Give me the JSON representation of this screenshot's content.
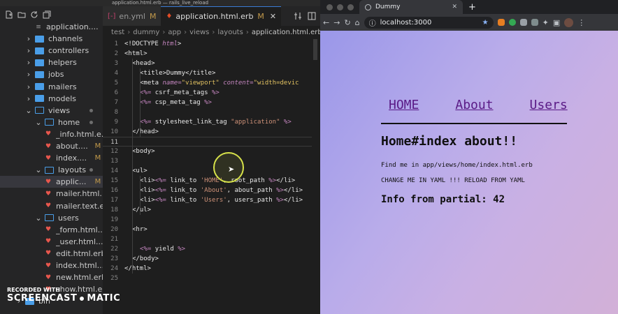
{
  "window_title": "application.html.erb — rails_live_reload",
  "explorer": {
    "rows": [
      {
        "label": "application....",
        "type": "file",
        "depth": 3,
        "icon": "css-file-icon",
        "badge": ""
      },
      {
        "label": "channels",
        "type": "folder",
        "depth": 2,
        "open": false
      },
      {
        "label": "controllers",
        "type": "folder",
        "depth": 2,
        "open": false
      },
      {
        "label": "helpers",
        "type": "folder",
        "depth": 2,
        "open": false
      },
      {
        "label": "jobs",
        "type": "folder",
        "depth": 2,
        "open": false
      },
      {
        "label": "mailers",
        "type": "folder",
        "depth": 2,
        "open": false
      },
      {
        "label": "models",
        "type": "folder",
        "depth": 2,
        "open": false
      },
      {
        "label": "views",
        "type": "folder",
        "depth": 2,
        "open": true,
        "dot": true
      },
      {
        "label": "home",
        "type": "folder",
        "depth": 3,
        "open": true,
        "dot": true
      },
      {
        "label": "_info.html.e...",
        "type": "file",
        "depth": 4,
        "icon": "ruby-file-icon",
        "badge": ""
      },
      {
        "label": "about....",
        "type": "file",
        "depth": 4,
        "icon": "ruby-file-icon",
        "badge": "M"
      },
      {
        "label": "index....",
        "type": "file",
        "depth": 4,
        "icon": "ruby-file-icon",
        "badge": "M"
      },
      {
        "label": "layouts",
        "type": "folder",
        "depth": 3,
        "open": true,
        "dot": true
      },
      {
        "label": "applic...",
        "type": "file",
        "depth": 4,
        "icon": "ruby-file-icon",
        "badge": "M",
        "selected": true
      },
      {
        "label": "mailer.html....",
        "type": "file",
        "depth": 4,
        "icon": "ruby-file-icon",
        "badge": ""
      },
      {
        "label": "mailer.text.e...",
        "type": "file",
        "depth": 4,
        "icon": "ruby-file-icon",
        "badge": ""
      },
      {
        "label": "users",
        "type": "folder",
        "depth": 3,
        "open": true
      },
      {
        "label": "_form.html....",
        "type": "file",
        "depth": 4,
        "icon": "ruby-file-icon",
        "badge": ""
      },
      {
        "label": "_user.html....",
        "type": "file",
        "depth": 4,
        "icon": "ruby-file-icon",
        "badge": ""
      },
      {
        "label": "edit.html.erb",
        "type": "file",
        "depth": 4,
        "icon": "ruby-file-icon",
        "badge": ""
      },
      {
        "label": "index.html....",
        "type": "file",
        "depth": 4,
        "icon": "ruby-file-icon",
        "badge": ""
      },
      {
        "label": "new.html.erb",
        "type": "file",
        "depth": 4,
        "icon": "ruby-file-icon",
        "badge": ""
      },
      {
        "label": "show.html.e...",
        "type": "file",
        "depth": 4,
        "icon": "ruby-file-icon",
        "badge": ""
      },
      {
        "label": "bin",
        "type": "folder",
        "depth": 1,
        "open": false
      }
    ]
  },
  "tabs": [
    {
      "label": "en.yml",
      "modified": "M",
      "icon": "yaml-file-icon",
      "active": false
    },
    {
      "label": "application.html.erb",
      "modified": "M",
      "icon": "ruby-file-icon",
      "active": true
    }
  ],
  "breadcrumb": [
    "test",
    "dummy",
    "app",
    "views",
    "layouts",
    "application.html.erb"
  ],
  "code": {
    "current_line": 11,
    "lines": [
      {
        "n": "1",
        "indent": 0,
        "parts": [
          [
            "tag",
            "<!DOCTYPE "
          ],
          [
            "attr",
            "html"
          ],
          [
            "tag",
            ">"
          ]
        ]
      },
      {
        "n": "2",
        "indent": 0,
        "parts": [
          [
            "tag",
            "<html>"
          ]
        ]
      },
      {
        "n": "3",
        "indent": 1,
        "parts": [
          [
            "tag",
            "<head>"
          ]
        ]
      },
      {
        "n": "4",
        "indent": 2,
        "parts": [
          [
            "tag",
            "<title>Dummy</title>"
          ]
        ]
      },
      {
        "n": "5",
        "indent": 2,
        "parts": [
          [
            "tag",
            "<meta "
          ],
          [
            "attr",
            "name="
          ],
          [
            "str2",
            "\"viewport\" "
          ],
          [
            "attr",
            "content="
          ],
          [
            "str2",
            "\"width=devic"
          ]
        ]
      },
      {
        "n": "6",
        "indent": 2,
        "parts": [
          [
            "erb",
            "<%= "
          ],
          [
            "tag",
            "csrf_meta_tags "
          ],
          [
            "erb",
            "%>"
          ]
        ]
      },
      {
        "n": "7",
        "indent": 2,
        "parts": [
          [
            "erb",
            "<%= "
          ],
          [
            "tag",
            "csp_meta_tag "
          ],
          [
            "erb",
            "%>"
          ]
        ]
      },
      {
        "n": "8",
        "indent": 0,
        "parts": []
      },
      {
        "n": "9",
        "indent": 2,
        "parts": [
          [
            "erb",
            "<%= "
          ],
          [
            "tag",
            "stylesheet_link_tag "
          ],
          [
            "str",
            "\"application\" "
          ],
          [
            "erb",
            "%>"
          ]
        ]
      },
      {
        "n": "10",
        "indent": 1,
        "parts": [
          [
            "tag",
            "</head>"
          ]
        ]
      },
      {
        "n": "11",
        "indent": 0,
        "parts": []
      },
      {
        "n": "12",
        "indent": 1,
        "parts": [
          [
            "tag",
            "<body>"
          ]
        ]
      },
      {
        "n": "13",
        "indent": 0,
        "parts": []
      },
      {
        "n": "14",
        "indent": 1,
        "parts": [
          [
            "tag",
            "<ul>"
          ]
        ]
      },
      {
        "n": "15",
        "indent": 2,
        "parts": [
          [
            "tag",
            "<li>"
          ],
          [
            "erb",
            "<%= "
          ],
          [
            "tag",
            "link_to "
          ],
          [
            "str",
            "'HOME'"
          ],
          [
            "tag",
            ", root_path "
          ],
          [
            "erb",
            "%>"
          ],
          [
            "tag",
            "</li>"
          ]
        ]
      },
      {
        "n": "16",
        "indent": 2,
        "parts": [
          [
            "tag",
            "<li>"
          ],
          [
            "erb",
            "<%= "
          ],
          [
            "tag",
            "link_to "
          ],
          [
            "str",
            "'About'"
          ],
          [
            "tag",
            ", about_path "
          ],
          [
            "erb",
            "%>"
          ],
          [
            "tag",
            "</li>"
          ]
        ]
      },
      {
        "n": "17",
        "indent": 2,
        "parts": [
          [
            "tag",
            "<li>"
          ],
          [
            "erb",
            "<%= "
          ],
          [
            "tag",
            "link_to "
          ],
          [
            "str",
            "'Users'"
          ],
          [
            "tag",
            ", users_path "
          ],
          [
            "erb",
            "%>"
          ],
          [
            "tag",
            "</li>"
          ]
        ]
      },
      {
        "n": "18",
        "indent": 1,
        "parts": [
          [
            "tag",
            "</ul>"
          ]
        ]
      },
      {
        "n": "19",
        "indent": 0,
        "parts": []
      },
      {
        "n": "20",
        "indent": 1,
        "parts": [
          [
            "tag",
            "<hr>"
          ]
        ]
      },
      {
        "n": "21",
        "indent": 0,
        "parts": []
      },
      {
        "n": "22",
        "indent": 2,
        "parts": [
          [
            "erb",
            "<%= "
          ],
          [
            "tag",
            "yield "
          ],
          [
            "erb",
            "%>"
          ]
        ]
      },
      {
        "n": "23",
        "indent": 1,
        "parts": [
          [
            "tag",
            "</body>"
          ]
        ]
      },
      {
        "n": "24",
        "indent": 0,
        "parts": [
          [
            "tag",
            "</html>"
          ]
        ]
      },
      {
        "n": "25",
        "indent": 0,
        "parts": []
      }
    ]
  },
  "watermark": {
    "line1": "RECORDED WITH",
    "brand_left": "SCREENCAST",
    "brand_right": "MATIC"
  },
  "browser": {
    "tab_title": "Dummy",
    "new_tab": "+",
    "url": "localhost:3000",
    "page": {
      "nav": [
        "HOME",
        "About",
        "Users"
      ],
      "heading": "Home#index about!!",
      "para1": "Find me in app/views/home/index.html.erb",
      "para2": "CHANGE ME IN YAML !!! RELOAD FROM YAML",
      "info": "Info from partial: 42"
    }
  },
  "colors": {
    "editor_bg": "#1e1e1e",
    "sidebar_bg": "#252526",
    "folder": "#4a9ee8",
    "ruby_icon": "#e8574d",
    "modified": "#c39a4b",
    "link": "#5a1a86",
    "highlight_circle": "#d7e24a"
  }
}
